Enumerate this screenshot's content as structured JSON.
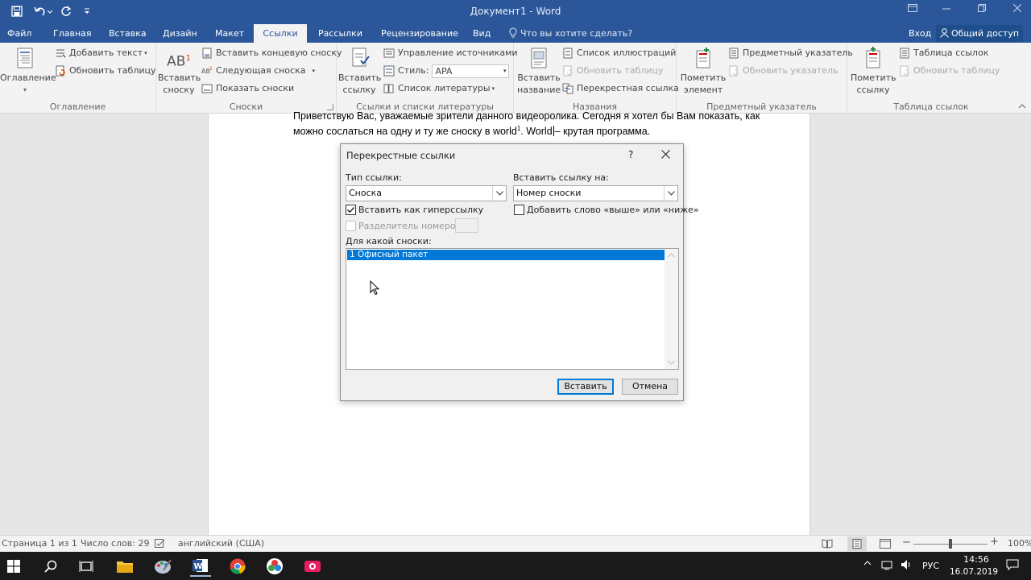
{
  "titlebar": {
    "doc_title": "Документ1 - Word"
  },
  "tabs": [
    {
      "label": "Файл",
      "active": false
    },
    {
      "label": "Главная",
      "active": false
    },
    {
      "label": "Вставка",
      "active": false
    },
    {
      "label": "Дизайн",
      "active": false
    },
    {
      "label": "Макет",
      "active": false
    },
    {
      "label": "Ссылки",
      "active": true
    },
    {
      "label": "Рассылки",
      "active": false
    },
    {
      "label": "Рецензирование",
      "active": false
    },
    {
      "label": "Вид",
      "active": false
    }
  ],
  "tellme": "Что вы хотите сделать?",
  "signin": "Вход",
  "share": "Общий доступ",
  "ribbon": {
    "toc": {
      "big": "Оглавление",
      "add_text": "Добавить текст",
      "update_table": "Обновить таблицу",
      "group": "Оглавление"
    },
    "footnotes": {
      "big_line1": "Вставить",
      "big_line2": "сноску",
      "endnote": "Вставить концевую сноску",
      "next": "Следующая сноска",
      "show": "Показать сноски",
      "group": "Сноски",
      "ab_glyph": "AB",
      "ab_sup": "1"
    },
    "citations": {
      "big_line1": "Вставить",
      "big_line2": "ссылку",
      "manage": "Управление источниками",
      "style_label": "Стиль:",
      "style_value": "APA",
      "biblio": "Список литературы",
      "group": "Ссылки и списки литературы"
    },
    "captions": {
      "big_line1": "Вставить",
      "big_line2": "название",
      "figures": "Список иллюстраций",
      "update": "Обновить таблицу",
      "crossref": "Перекрестная ссылка",
      "group": "Названия"
    },
    "index": {
      "big_line1": "Пометить",
      "big_line2": "элемент",
      "insert": "Предметный указатель",
      "update": "Обновить указатель",
      "group": "Предметный указатель"
    },
    "toa": {
      "big_line1": "Пометить",
      "big_line2": "ссылку",
      "insert": "Таблица ссылок",
      "update": "Обновить таблицу",
      "group": "Таблица ссылок"
    }
  },
  "document": {
    "line1": "Приветствую Вас, уважаемые зрители данного видеоролика. Сегодня я хотел бы Вам показать, как",
    "line2_a": "можно сослаться на одну и ту же сноску в world",
    "line2_sup": "1",
    "line2_b": ". World",
    "line2_c": "– крутая программа."
  },
  "dialog": {
    "title": "Перекрестные ссылки",
    "help": "?",
    "ref_type_label": "Тип ссылки:",
    "ref_type_value": "Сноска",
    "insert_ref_label": "Вставить ссылку на:",
    "insert_ref_value": "Номер сноски",
    "hyperlink_label": "Вставить как гиперссылку",
    "hyperlink_checked": true,
    "above_below_label": "Добавить слово «выше» или «ниже»",
    "above_below_checked": false,
    "separator_label": "Разделитель номеров",
    "which_label": "Для какой сноски:",
    "items": [
      "1  Офисный пакет"
    ],
    "insert_btn": "Вставить",
    "cancel_btn": "Отмена"
  },
  "statusbar": {
    "page": "Страница 1 из 1",
    "words": "Число слов: 29",
    "language": "английский (США)",
    "zoom": "100%",
    "minus": "−",
    "plus": "+"
  },
  "taskbar": {
    "lang": "РУС",
    "time": "14:56",
    "date": "16.07.2019"
  },
  "colors": {
    "word_blue": "#2b579a",
    "selection": "#0078d7"
  }
}
